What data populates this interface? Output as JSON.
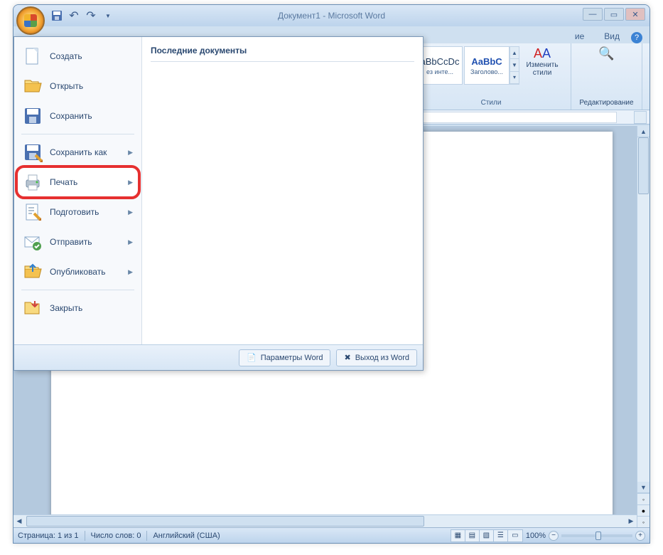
{
  "title": "Документ1 - Microsoft Word",
  "visible_tabs": [
    "ие",
    "Вид"
  ],
  "ribbon": {
    "style1_preview": "aBbCcDc",
    "style1_label": "ез инте...",
    "style2_preview": "AaBbC",
    "style2_label": "Заголово...",
    "styles_group_label": "Стили",
    "change_styles_label": "Изменить\nстили",
    "editing_label": "Редактирование"
  },
  "office_menu": {
    "items": [
      {
        "label": "Создать",
        "icon": "new"
      },
      {
        "label": "Открыть",
        "icon": "open"
      },
      {
        "label": "Сохранить",
        "icon": "save"
      },
      {
        "label": "Сохранить как",
        "icon": "save-as",
        "arrow": true
      },
      {
        "label": "Печать",
        "icon": "print",
        "arrow": true,
        "highlighted": true
      },
      {
        "label": "Подготовить",
        "icon": "prepare",
        "arrow": true
      },
      {
        "label": "Отправить",
        "icon": "send",
        "arrow": true
      },
      {
        "label": "Опубликовать",
        "icon": "publish",
        "arrow": true
      },
      {
        "label": "Закрыть",
        "icon": "close"
      }
    ],
    "recent_header": "Последние документы",
    "footer_options": "Параметры Word",
    "footer_exit": "Выход из Word"
  },
  "statusbar": {
    "page": "Страница: 1 из 1",
    "words": "Число слов: 0",
    "language": "Английский (США)",
    "zoom": "100%"
  }
}
